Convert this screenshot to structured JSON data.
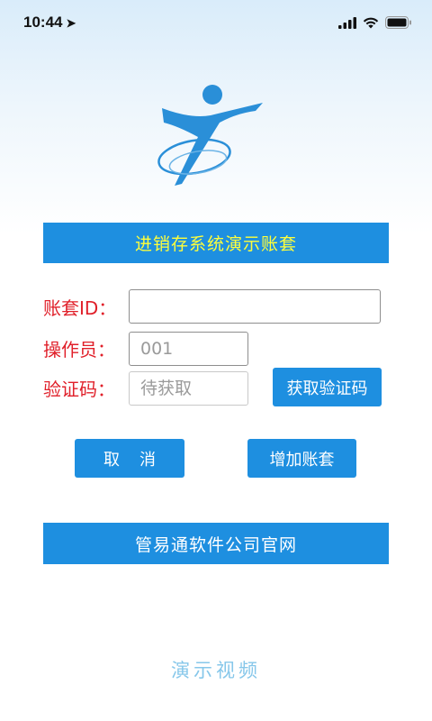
{
  "status_bar": {
    "time": "10:44",
    "location_glyph": "➤",
    "icons": [
      "signal-icon",
      "wifi-icon",
      "battery-icon"
    ]
  },
  "app": {
    "logo": "runner-logo-icon",
    "title": "进销存系统演示账套",
    "colors": {
      "accent": "#1e8fe0",
      "title_text": "#ffff3b",
      "label_text": "#e0202a"
    }
  },
  "form": {
    "account_label": "账套ID：",
    "account_value": "",
    "operator_label": "操作员：",
    "operator_placeholder": "001",
    "code_label": "验证码：",
    "code_placeholder": "待获取",
    "get_code_button": "获取验证码"
  },
  "actions": {
    "cancel_button": "取消",
    "add_account_button": "增加账套"
  },
  "footer": {
    "website_button": "管易通软件公司官网",
    "demo_video_link": "演示视频"
  }
}
